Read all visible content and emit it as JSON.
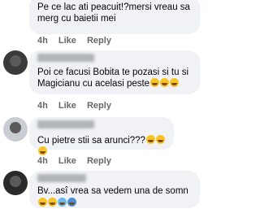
{
  "comments": [
    {
      "text": "Pe ce lac ati peacuit!?mersi vreau sa\nmerg cu baietii mei",
      "time": "4h",
      "like": "Like",
      "reply": "Reply"
    },
    {
      "text": "Poi ce facusi Bobita te pozasi si tu si\nMagicianu cu acelasi peste",
      "time": "4h",
      "like": "Like",
      "reply": "Reply"
    },
    {
      "text": "Cu pietre stii sa arunci???",
      "time": "4h",
      "like": "Like",
      "reply": "Reply"
    },
    {
      "text": "Bv...asî vrea sa vedem una de somn",
      "time": "",
      "like": "",
      "reply": ""
    }
  ],
  "colors": {
    "bubble": "#f0f2f5",
    "meta": "#65676b",
    "text": "#050505"
  }
}
